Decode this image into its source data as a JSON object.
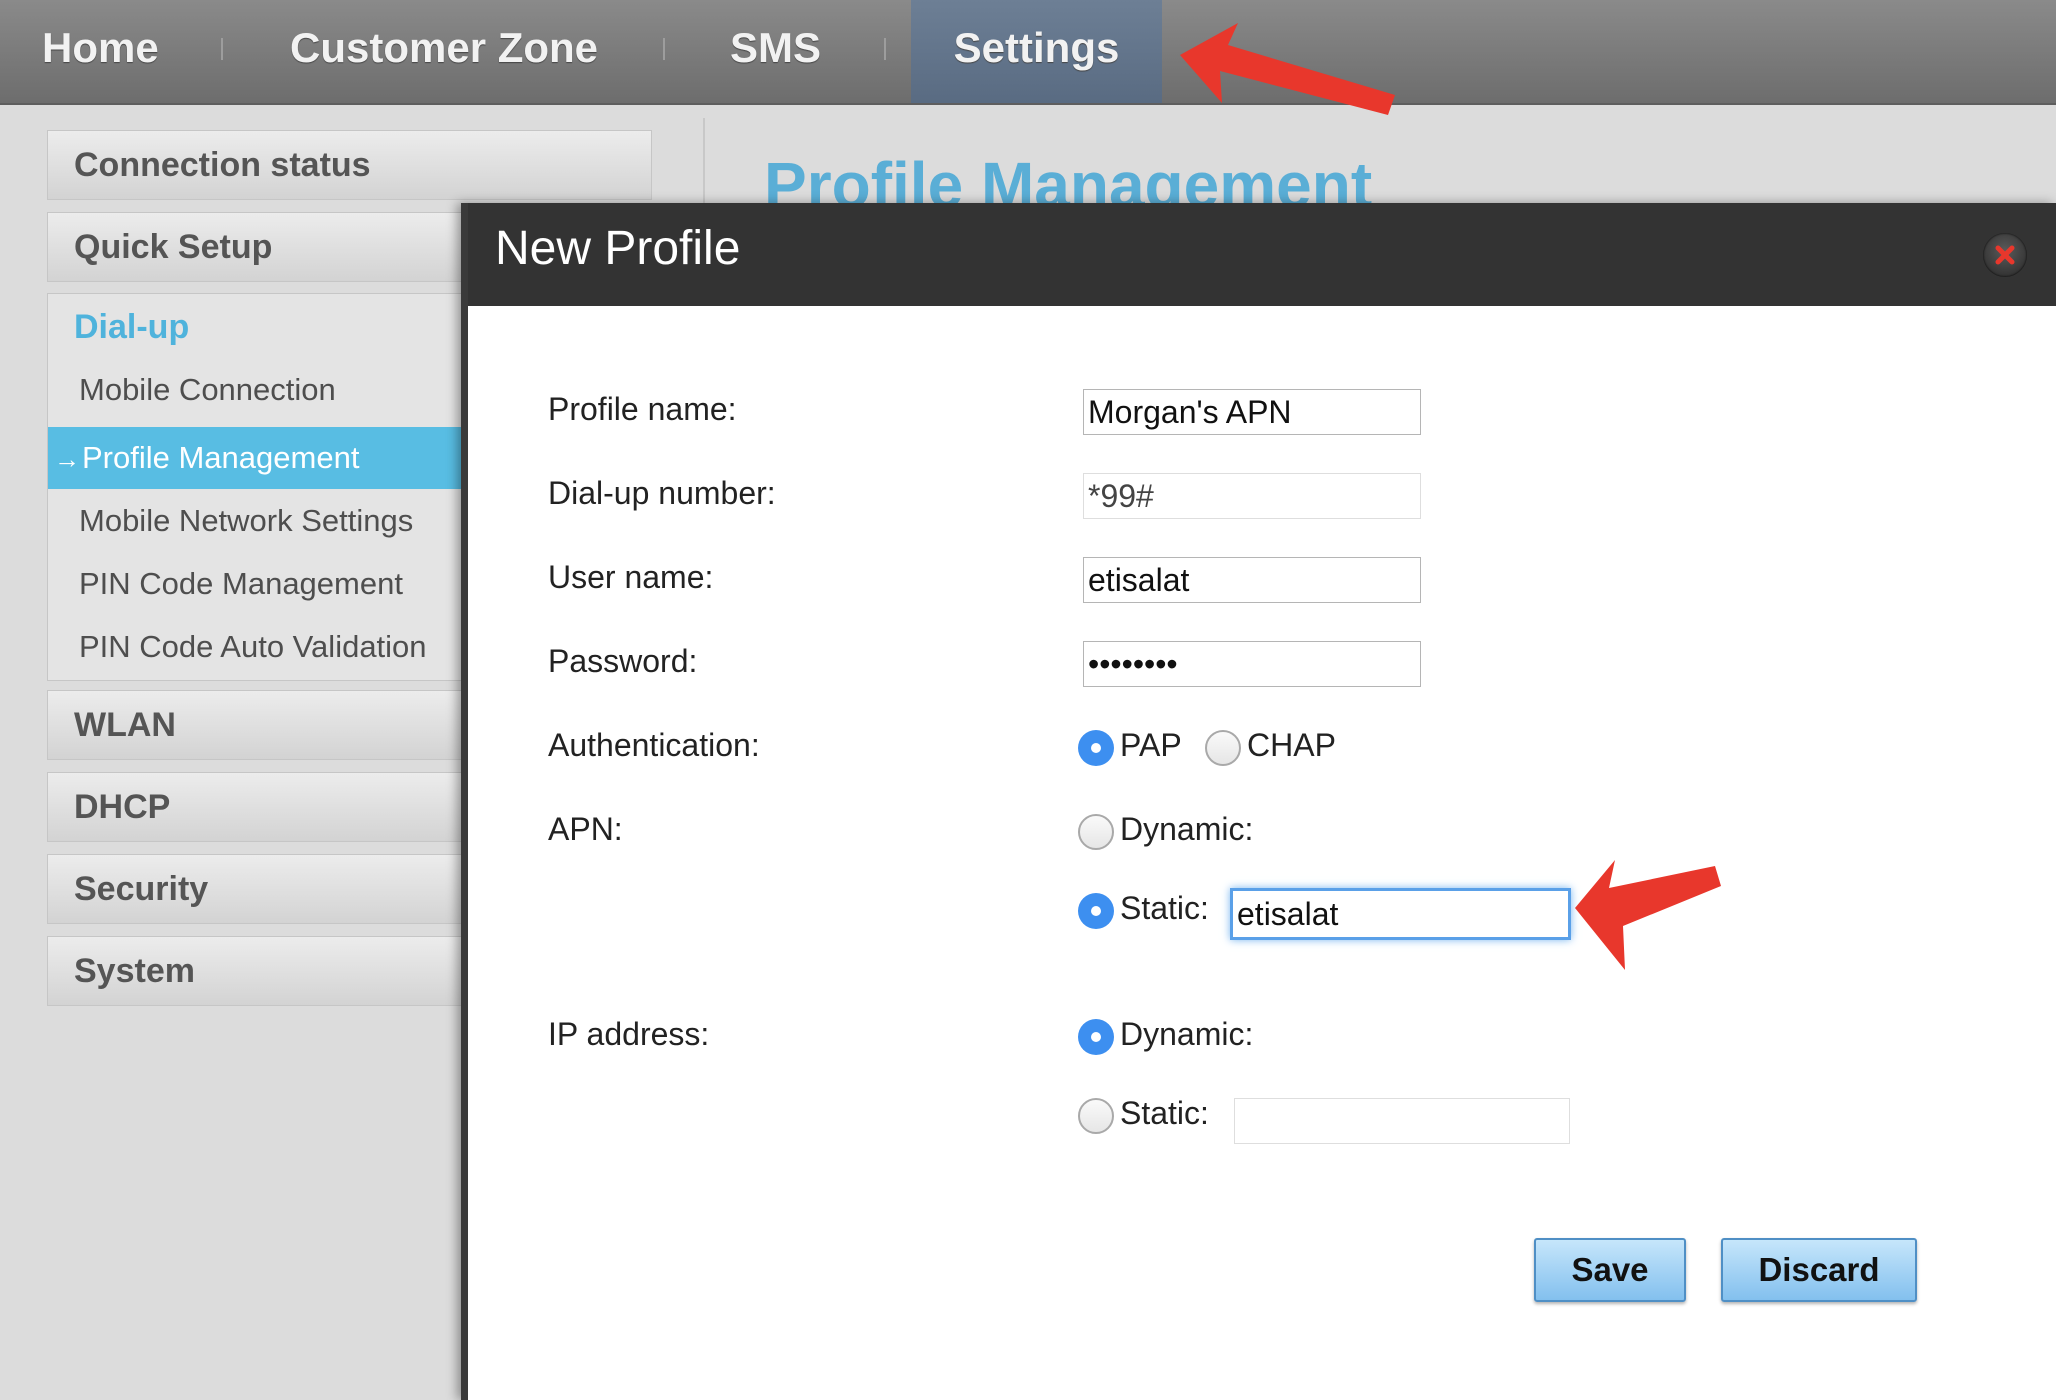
{
  "nav": {
    "home": "Home",
    "customer_zone": "Customer Zone",
    "sms": "SMS",
    "settings": "Settings"
  },
  "sidebar": {
    "connection_status": "Connection status",
    "quick_setup": "Quick Setup",
    "dialup": {
      "title": "Dial-up",
      "items": [
        {
          "label": "Mobile Connection"
        },
        {
          "label": "Profile Management",
          "active": true
        },
        {
          "label": "Mobile Network Settings"
        },
        {
          "label": "PIN Code Management"
        },
        {
          "label": "PIN Code Auto Validation"
        }
      ]
    },
    "wlan": "WLAN",
    "dhcp": "DHCP",
    "security": "Security",
    "system": "System"
  },
  "page_title": "Profile Management",
  "modal": {
    "title": "New Profile",
    "close_icon": "close-icon",
    "labels": {
      "profile_name": "Profile name:",
      "dialup_number": "Dial-up number:",
      "user_name": "User name:",
      "password": "Password:",
      "authentication": "Authentication:",
      "apn": "APN:",
      "ip_address": "IP address:"
    },
    "values": {
      "profile_name": "Morgan's APN",
      "dialup_number": "*99#",
      "user_name": "etisalat",
      "password": "••••••••",
      "apn_static": "etisalat",
      "ip_static": ""
    },
    "auth_options": {
      "pap": "PAP",
      "chap": "CHAP",
      "selected": "PAP"
    },
    "apn_options": {
      "dynamic": "Dynamic:",
      "static": "Static:",
      "selected": "Static"
    },
    "ip_options": {
      "dynamic": "Dynamic:",
      "static": "Static:",
      "selected": "Dynamic"
    },
    "buttons": {
      "save": "Save",
      "discard": "Discard"
    }
  },
  "colors": {
    "accent": "#58bde3",
    "radio_selected": "#3d8ff0",
    "annotation_arrow": "#e8372c"
  }
}
